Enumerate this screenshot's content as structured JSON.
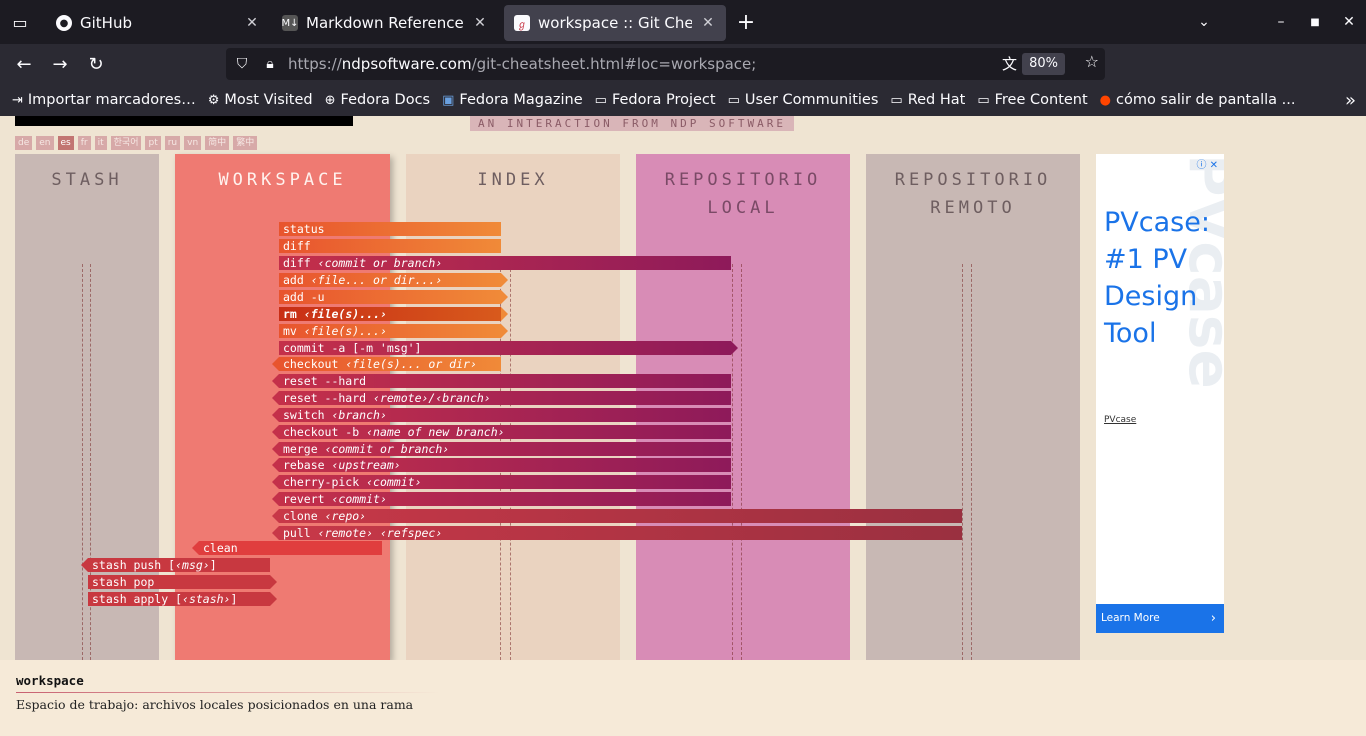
{
  "browser": {
    "tabs": [
      {
        "title": "GitHub",
        "icon": "github-icon",
        "active": false
      },
      {
        "title": "Markdown Reference",
        "icon": "markdown-icon",
        "active": false
      },
      {
        "title": "workspace :: Git Cheatshe",
        "icon": "ndp-icon",
        "active": true
      }
    ],
    "url_prefix": "https://",
    "url_host": "ndpsoftware.com",
    "url_path": "/git-cheatsheet.html#loc=workspace;",
    "zoom": "80%",
    "bookmarks": [
      {
        "label": "Importar marcadores…",
        "icon": "import-icon"
      },
      {
        "label": "Most Visited",
        "icon": "gear-icon"
      },
      {
        "label": "Fedora Docs",
        "icon": "globe-icon"
      },
      {
        "label": "Fedora Magazine",
        "icon": "fedora-magazine-icon"
      },
      {
        "label": "Fedora Project",
        "icon": "folder-icon"
      },
      {
        "label": "User Communities",
        "icon": "folder-icon"
      },
      {
        "label": "Red Hat",
        "icon": "folder-icon"
      },
      {
        "label": "Free Content",
        "icon": "folder-icon"
      },
      {
        "label": "cómo salir de pantalla ...",
        "icon": "reddit-icon"
      }
    ]
  },
  "page": {
    "tagline": "AN INTERACTION FROM NDP SOFTWARE",
    "languages": [
      "de",
      "en",
      "es",
      "fr",
      "it",
      "한국어",
      "pt",
      "ru",
      "vn",
      "简中",
      "繁中"
    ],
    "selected_language": "es",
    "columns": {
      "stash": "STASH",
      "workspace": "WORKSPACE",
      "index": "INDEX",
      "local_1": "REPOSITORIO",
      "local_2": "LOCAL",
      "remote_1": "REPOSITORIO",
      "remote_2": "REMOTO"
    },
    "commands": [
      {
        "cmd": "status",
        "arg": ""
      },
      {
        "cmd": "diff",
        "arg": ""
      },
      {
        "cmd": "diff",
        "arg": "‹commit or branch›"
      },
      {
        "cmd": "add",
        "arg": "‹file... or dir...›"
      },
      {
        "cmd": "add -u",
        "arg": ""
      },
      {
        "cmd": "rm",
        "arg": "‹file(s)...›"
      },
      {
        "cmd": "mv",
        "arg": "‹file(s)...›"
      },
      {
        "cmd": "commit -a [-m 'msg']",
        "arg": ""
      },
      {
        "cmd": "checkout",
        "arg": "‹file(s)... or dir›"
      },
      {
        "cmd": "reset --hard",
        "arg": ""
      },
      {
        "cmd": "reset --hard",
        "arg": "‹remote›/‹branch›"
      },
      {
        "cmd": "switch",
        "arg": "‹branch›"
      },
      {
        "cmd": "checkout -b",
        "arg": "‹name of new branch›"
      },
      {
        "cmd": "merge",
        "arg": "‹commit or branch›"
      },
      {
        "cmd": "rebase",
        "arg": "‹upstream›"
      },
      {
        "cmd": "cherry-pick",
        "arg": "‹commit›"
      },
      {
        "cmd": "revert",
        "arg": "‹commit›"
      },
      {
        "cmd": "clone",
        "arg": "‹repo›"
      },
      {
        "cmd": "pull",
        "arg": "‹remote› ‹refspec›"
      },
      {
        "cmd": "clean",
        "arg": ""
      },
      {
        "cmd": "stash push [",
        "arg": "‹msg›",
        "suffix": "]"
      },
      {
        "cmd": "stash pop",
        "arg": ""
      },
      {
        "cmd": "stash apply [",
        "arg": "‹stash›",
        "suffix": "]"
      }
    ],
    "info_title": "workspace",
    "info_text": "Espacio de trabajo: archivos locales posicionados en una rama"
  },
  "ad": {
    "bg_text": "PVcase",
    "headline": "PVcase: #1 PV Design Tool",
    "brand": "PVcase",
    "cta": "Learn More"
  }
}
